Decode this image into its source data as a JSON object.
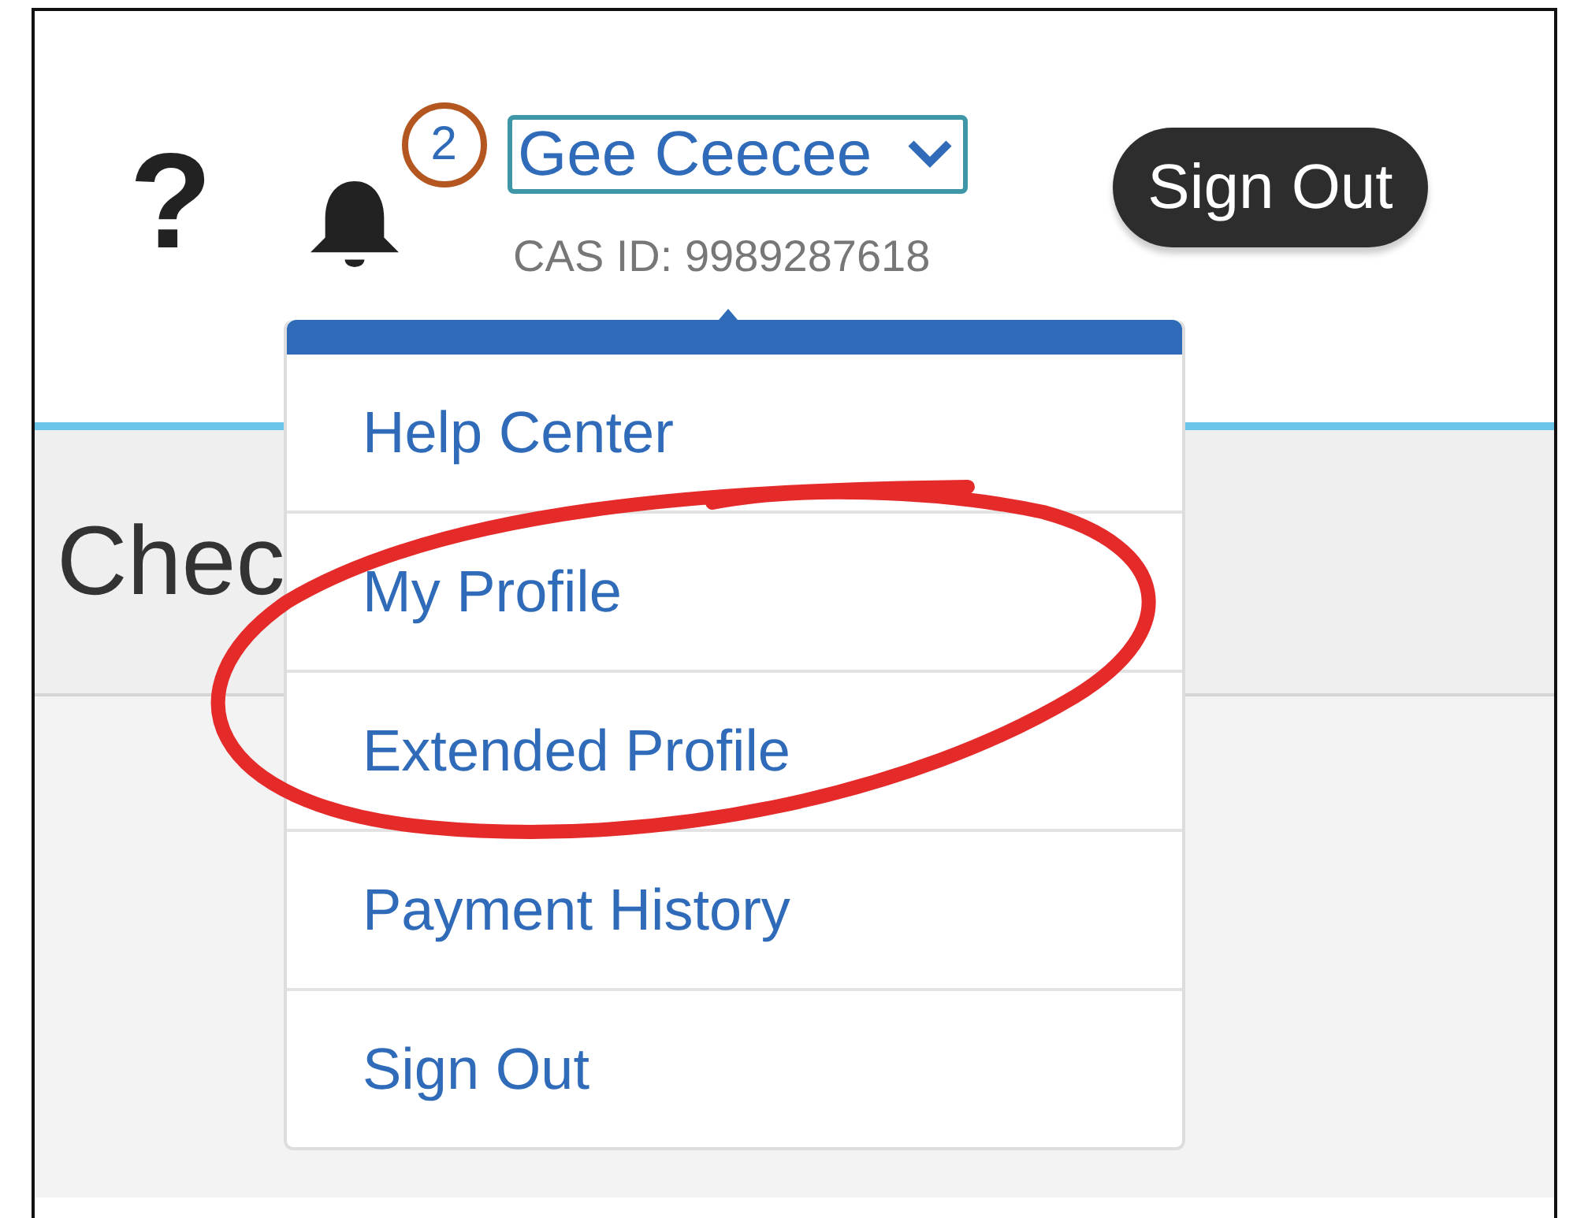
{
  "header": {
    "help": "?",
    "notifications": {
      "count": "2"
    },
    "user_menu": {
      "name": "Gee Ceecee",
      "expanded": true
    },
    "cas_id": "CAS ID: 9989287618",
    "sign_out": "Sign Out"
  },
  "page": {
    "heading": "Chec"
  },
  "dropdown_menu": {
    "items": [
      {
        "label": "Help Center"
      },
      {
        "label": "My Profile"
      },
      {
        "label": "Extended Profile"
      },
      {
        "label": "Payment History"
      },
      {
        "label": "Sign Out"
      }
    ]
  }
}
